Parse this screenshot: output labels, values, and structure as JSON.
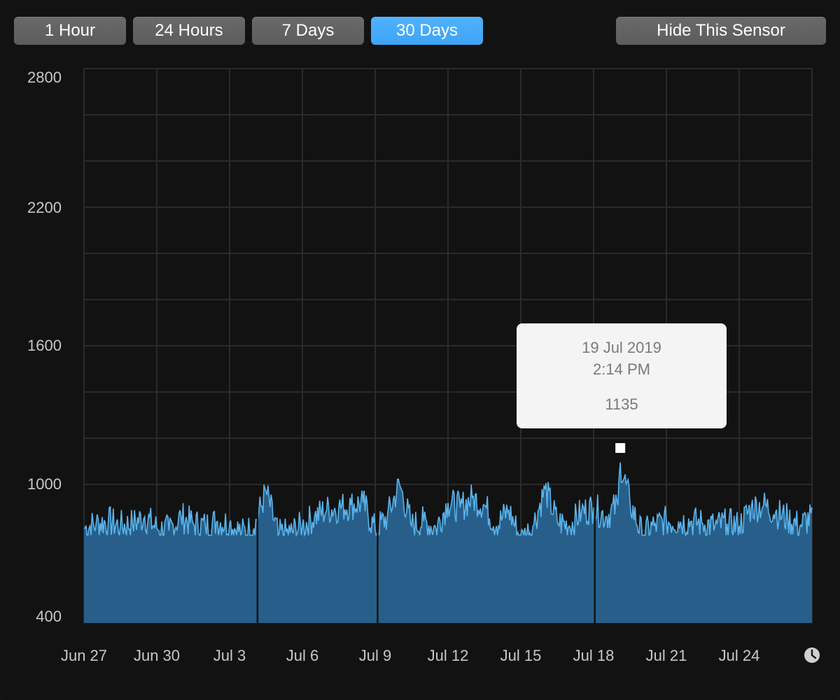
{
  "toolbar": {
    "range_buttons": [
      {
        "label": "1 Hour",
        "selected": false
      },
      {
        "label": "24 Hours",
        "selected": false
      },
      {
        "label": "7 Days",
        "selected": false
      },
      {
        "label": "30 Days",
        "selected": true
      }
    ],
    "hide_label": "Hide This Sensor"
  },
  "tooltip": {
    "date": "19 Jul 2019",
    "time": "2:14 PM",
    "value": "1135"
  },
  "colors": {
    "background": "#121212",
    "line": "#5ab4ec",
    "fill": "#275f8a",
    "button_gray": "#5f5f5f",
    "button_selected": "#44a8f8",
    "grid": "#2a2a2a",
    "tooltip_bg": "#f4f4f4"
  },
  "icons": {
    "clock": "clock-icon"
  },
  "chart_data": {
    "type": "area",
    "y_ticks": [
      "2800",
      "2200",
      "1600",
      "1000",
      "400"
    ],
    "ylim": [
      400,
      2800
    ],
    "x_ticks": [
      "Jun 27",
      "Jun 30",
      "Jul 3",
      "Jul 6",
      "Jul 9",
      "Jul 12",
      "Jul 15",
      "Jul 18",
      "Jul 21",
      "Jul 24"
    ],
    "x_tick_days": [
      0,
      3,
      6,
      9,
      12,
      15,
      18,
      21,
      24,
      27
    ],
    "xlim_days": [
      0,
      30
    ],
    "grid": true,
    "highlight": {
      "day": 22.1,
      "value": 1135
    },
    "gaps_days": [
      7.15,
      12.1,
      21.05
    ],
    "series": [
      {
        "x_days": [
          0.0,
          0.5,
          1.0,
          1.5,
          2.0,
          2.5,
          3.0,
          3.5,
          4.0,
          4.5,
          5.0,
          5.5,
          6.0,
          6.5,
          7.0,
          7.5,
          8.0,
          8.5,
          9.0,
          9.5,
          10.0,
          10.5,
          11.0,
          11.5,
          12.0,
          12.5,
          13.0,
          13.5,
          14.0,
          14.5,
          15.0,
          15.5,
          16.0,
          16.5,
          17.0,
          17.5,
          18.0,
          18.5,
          19.0,
          19.5,
          20.0,
          20.5,
          21.0,
          21.5,
          22.0,
          22.1,
          22.5,
          23.0,
          23.5,
          24.0,
          24.5,
          25.0,
          25.5,
          26.0,
          26.5,
          27.0,
          27.5,
          28.0,
          28.5,
          29.0,
          29.5,
          30.0
        ],
        "values": [
          850,
          870,
          880,
          860,
          870,
          900,
          850,
          840,
          900,
          870,
          860,
          880,
          870,
          830,
          850,
          1010,
          820,
          830,
          860,
          900,
          930,
          940,
          950,
          960,
          840,
          900,
          1040,
          860,
          880,
          850,
          960,
          940,
          980,
          950,
          860,
          930,
          800,
          860,
          1020,
          880,
          860,
          920,
          940,
          900,
          950,
          1135,
          960,
          820,
          860,
          880,
          880,
          880,
          870,
          860,
          870,
          860,
          940,
          950,
          920,
          890,
          860,
          900
        ]
      }
    ]
  }
}
